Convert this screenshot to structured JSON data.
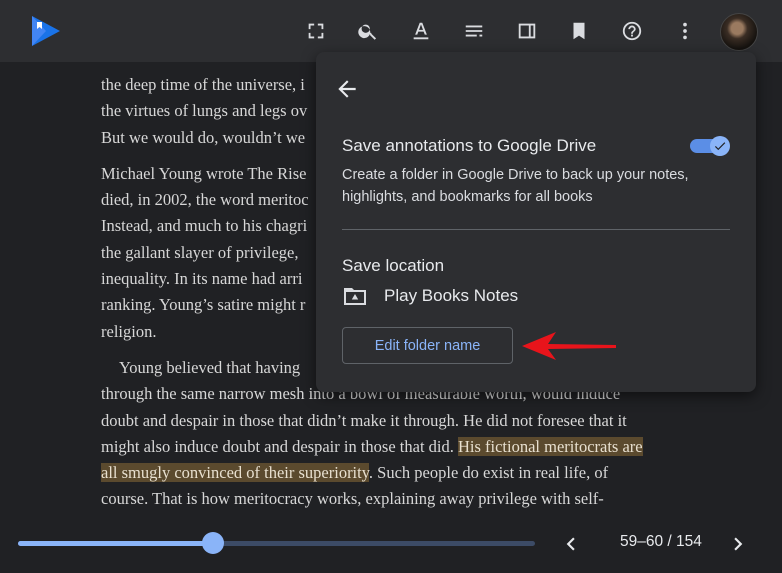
{
  "toolbar": {
    "icons": [
      "fullscreen-icon",
      "search-icon",
      "text-format-icon",
      "contents-icon",
      "display-options-icon",
      "bookmark-icon",
      "help-icon",
      "more-icon"
    ]
  },
  "book": {
    "paragraphs": [
      {
        "indent": false,
        "lines": [
          "the deep time of the universe, i",
          "the virtues of lungs and legs ov",
          "But we would do, wouldn’t we"
        ]
      },
      {
        "indent": false,
        "lines": [
          "Michael Young wrote The Rise",
          "died, in 2002, the word meritoc",
          "Instead, and much to his chagri",
          "the gallant slayer of privilege, ",
          "inequality. In its name had arri",
          "ranking. Young’s satire might r",
          "religion."
        ]
      },
      {
        "indent": true,
        "lines": [
          "Young believed that having",
          "through the same narrow mesh into a bowl of measurable worth, would induce",
          "doubt and despair in those that didn’t make it through. He did not foresee that it",
          "might also induce doubt and despair in those that did. "
        ]
      }
    ],
    "highlight_1": "His fictional meritocrats are",
    "highlight_2": "all smugly convinced of their superiority",
    "after_highlight": ". Such people do exist in real life, of",
    "line_course": "course. That is how meritocracy works, explaining away privilege with self-"
  },
  "panel": {
    "title": "Save annotations to Google Drive",
    "description": "Create a folder in Google Drive to back up your notes, highlights, and bookmarks for all books",
    "toggle_on": true,
    "save_location_label": "Save location",
    "folder_name": "Play Books Notes",
    "edit_button": "Edit folder name"
  },
  "progress": {
    "fraction": 0.378,
    "pages_label": "59–60 / 154"
  },
  "colors": {
    "accent": "#8ab4f8",
    "annotation_arrow": "#e8141b",
    "highlight": "#5b4a2e"
  }
}
